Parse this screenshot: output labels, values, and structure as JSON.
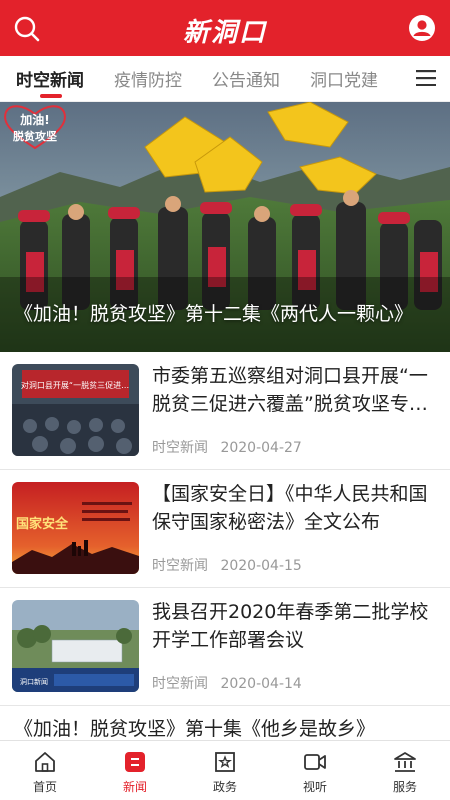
{
  "header": {
    "logo_text": "新洞口",
    "brand_color": "#e3222b"
  },
  "tabs": [
    {
      "label": "时空新闻",
      "active": true
    },
    {
      "label": "疫情防控"
    },
    {
      "label": "公告通知"
    },
    {
      "label": "洞口党建"
    }
  ],
  "banner": {
    "caption": "《加油！脱贫攻坚》第十二集《两代人一颗心》",
    "badge_line1": "加油!",
    "badge_line2": "脱贫攻坚",
    "slide_count": 5,
    "active_slide": 1
  },
  "news": [
    {
      "title": "市委第五巡察组对洞口县开展“一脱贫三促进六覆盖”脱贫攻坚专项巡察",
      "source": "时空新闻",
      "date": "2020-04-27",
      "thumb_text": "对洞口县开展“一脱贫三促进…"
    },
    {
      "title": "【国家安全日】《中华人民共和国保守国家秘密法》全文公布",
      "source": "时空新闻",
      "date": "2020-04-15",
      "thumb_text": "国家安全"
    },
    {
      "title": "我县召开2020年春季第二批学校开学工作部署会议",
      "source": "时空新闻",
      "date": "2020-04-14",
      "thumb_text": "洞口新闻"
    }
  ],
  "partial_news": {
    "title": "《加油！脱贫攻坚》第十集《他乡是故乡》"
  },
  "bottom_nav": [
    {
      "label": "首页",
      "icon": "home-icon"
    },
    {
      "label": "新闻",
      "icon": "news-icon",
      "active": true
    },
    {
      "label": "政务",
      "icon": "government-icon"
    },
    {
      "label": "视听",
      "icon": "video-icon"
    },
    {
      "label": "服务",
      "icon": "service-icon"
    }
  ]
}
